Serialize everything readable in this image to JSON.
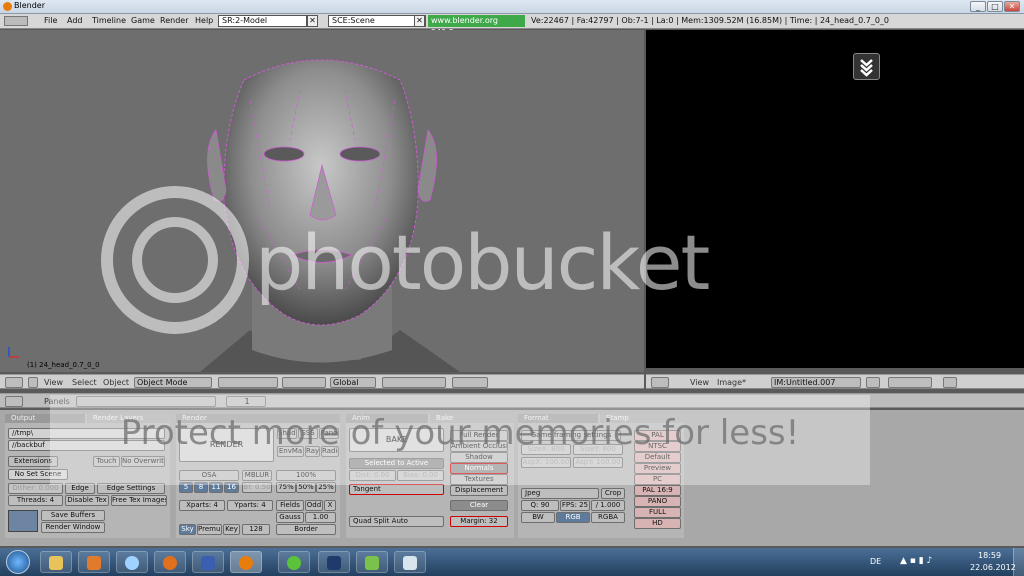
{
  "window": {
    "title": "Blender",
    "controls": [
      "_",
      "□",
      "✕"
    ]
  },
  "menubar": {
    "items": [
      "File",
      "Add",
      "Timeline",
      "Game",
      "Render",
      "Help"
    ],
    "screen": "SR:2-Model",
    "scene": "SCE:Scene",
    "url": "www.blender.org 249.2",
    "stats": "Ve:22467 | Fa:42797 | Ob:7-1 | La:0 | Mem:1309.52M (16.85M) | Time: | 24_head_0.7_0_0"
  },
  "viewport": {
    "object_label": "(1) 24_head_0.7_0_0"
  },
  "view3d_header": {
    "menus": [
      "View",
      "Select",
      "Object"
    ],
    "mode": "Object Mode",
    "pivot": "Global"
  },
  "image_header": {
    "menus": [
      "View",
      "Image*"
    ],
    "image": "IM:Untitled.007"
  },
  "buttons_header": {
    "panels_label": "Panels",
    "frame": "1"
  },
  "output_panel": {
    "tab_output": "Output",
    "tab_render_layers": "Render Layers",
    "path1": "//tmp\\",
    "path2": "//backbuf",
    "extensions": "Extensions",
    "touch": "Touch",
    "no_overwrite": "No Overwrite",
    "no_set_scene": "No Set Scene",
    "dither": "Dither: 0.000",
    "edge": "Edge",
    "edge_settings": "Edge Settings",
    "threads": "Threads: 4",
    "disable_tex": "Disable Tex",
    "free_tex": "Free Tex Images",
    "save_buffers": "Save Buffers",
    "render_window": "Render Window"
  },
  "render_panel": {
    "tab": "Render",
    "render": "RENDER",
    "shadow": "Shadow",
    "sss": "SSS",
    "pano": "Pano",
    "envmap": "EnvMa",
    "ray": "Ray",
    "radio": "Radio",
    "osa": "OSA",
    "osa_vals": [
      "5",
      "8",
      "11",
      "16"
    ],
    "mblur": "MBLUR",
    "bf": "Bf: 0.50",
    "percent": "100%",
    "percents": [
      "75%",
      "50%",
      "25%"
    ],
    "xparts": "Xparts: 4",
    "yparts": "Yparts: 4",
    "fields": "Fields",
    "odd": "Odd",
    "x": "X",
    "gauss": "Gauss",
    "gauss_val": "1.00",
    "sky": "Sky",
    "premul": "Premul",
    "key": "Key",
    "depth": "128",
    "border": "Border"
  },
  "bake_panel": {
    "tab_anim": "Anim",
    "tab_bake": "Bake",
    "bake": "BAKE",
    "selected_to_active": "Selected to Active",
    "dist": "Dist: 0.00",
    "bias": "Bias: 0.00",
    "space": "Tangent",
    "modes": [
      "Full Render",
      "Ambient Occlusion",
      "Shadow",
      "Normals",
      "Textures",
      "Displacement"
    ],
    "clear": "Clear",
    "margin": "Margin: 32",
    "quad": "Quad Split Auto"
  },
  "format_panel": {
    "tab_format": "Format",
    "tab_stamp": "Stamp",
    "game_framing": "Game framing settings",
    "sizex": "SizeX: 800",
    "sizey": "SizeY: 600",
    "aspx": "AspX: 100.00",
    "aspy": "AspY: 100.00",
    "format": "Jpeg",
    "crop": "Crop",
    "quality": "Q: 90",
    "fps": "FPS: 25",
    "fps_base": "/ 1.000",
    "bw": "BW",
    "rgb": "RGB",
    "rgba": "RGBA",
    "presets": [
      "PAL",
      "NTSC",
      "Default",
      "Preview",
      "PC",
      "PAL 16:9",
      "PANO",
      "FULL",
      "HD"
    ]
  },
  "watermark": {
    "brand": "photobucket",
    "tagline": "Protect more of your memories for less!"
  },
  "taskbar": {
    "lang": "DE",
    "time": "18:59",
    "date": "22.06.2012"
  },
  "colors": {
    "accent_green": "#3fa94a",
    "blender_orange": "#e87d0d",
    "wire_pink": "#d05ad6"
  }
}
